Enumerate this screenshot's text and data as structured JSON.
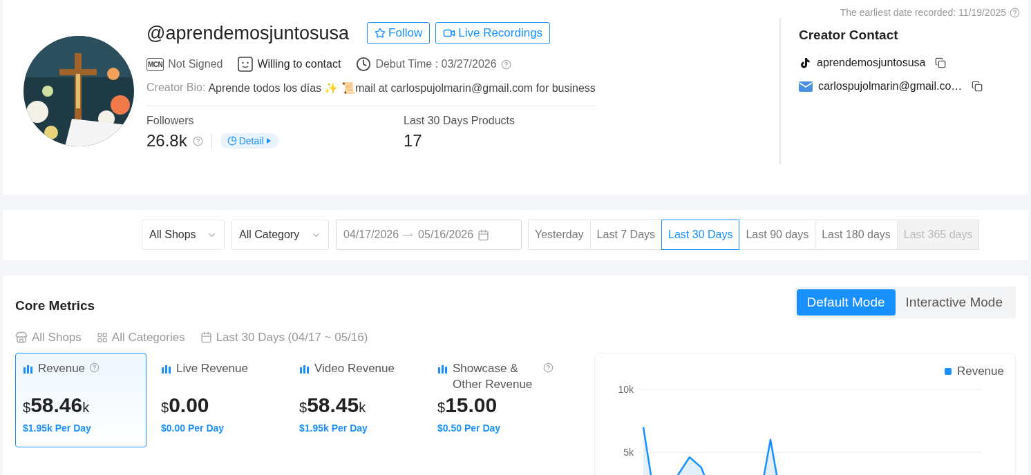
{
  "earliest_date": "The earliest date recorded: 11/19/2025",
  "profile": {
    "handle": "@aprendemosjuntosusa",
    "follow_button": "Follow",
    "live_button": "Live Recordings",
    "mcn_badge": "MCN",
    "mcn_status": "Not Signed",
    "contact_status": "Willing to contact",
    "debut": "Debut Time : 03/27/2026",
    "bio_label": "Creator Bio:",
    "bio": "Aprende todos los días ✨ 📜mail at carlospujolmarin@gmail.com for business",
    "stats": [
      {
        "label": "Followers",
        "value": "26.8k",
        "detail": "Detail"
      },
      {
        "label": "Last 30 Days Products",
        "value": "17"
      }
    ]
  },
  "contact": {
    "title": "Creator Contact",
    "items": [
      {
        "kind": "tiktok",
        "text": "aprendemosjuntosusa"
      },
      {
        "kind": "email",
        "text": "carlospujolmarin@gmail.co…"
      }
    ]
  },
  "filters": {
    "shop": "All Shops",
    "category": "All Category",
    "date_start": "04/17/2026",
    "date_end": "05/16/2026",
    "ranges": [
      {
        "label": "Yesterday",
        "selected": false,
        "disabled": false
      },
      {
        "label": "Last 7 Days",
        "selected": false,
        "disabled": false
      },
      {
        "label": "Last 30 Days",
        "selected": true,
        "disabled": false
      },
      {
        "label": "Last 90 days",
        "selected": false,
        "disabled": false
      },
      {
        "label": "Last 180 days",
        "selected": false,
        "disabled": false
      },
      {
        "label": "Last 365 days",
        "selected": false,
        "disabled": true
      }
    ]
  },
  "core_metrics": {
    "title": "Core Metrics",
    "modes": [
      {
        "label": "Default Mode",
        "selected": true
      },
      {
        "label": "Interactive Mode",
        "selected": false
      }
    ],
    "summary": [
      {
        "kind": "shop",
        "text": "All Shops"
      },
      {
        "kind": "category",
        "text": "All Categories"
      },
      {
        "kind": "date",
        "text": "Last 30 Days (04/17 ~ 05/16)"
      }
    ],
    "metrics": [
      {
        "label": "Revenue",
        "currency": "$",
        "amount": "58.46",
        "unit": "k",
        "per_day": "$1.95k Per Day",
        "selected": true,
        "help": true
      },
      {
        "label": "Live Revenue",
        "currency": "$",
        "amount": "0.00",
        "per_day": "$0.00 Per Day",
        "selected": false,
        "help": false
      },
      {
        "label": "Video Revenue",
        "currency": "$",
        "amount": "58.45",
        "unit": "k",
        "per_day": "$1.95k Per Day",
        "selected": false,
        "help": false
      },
      {
        "label": "Showcase & Other Revenue",
        "currency": "$",
        "amount": "15.00",
        "per_day": "$0.50 Per Day",
        "selected": false,
        "help": true
      }
    ],
    "chart": {
      "chart_data": {
        "type": "area",
        "categories": [
          null,
          null,
          null,
          null,
          null,
          null,
          null,
          null,
          null,
          null,
          null,
          null,
          null,
          null,
          null,
          null,
          null,
          null,
          null,
          null,
          null,
          null,
          null,
          null,
          null,
          null,
          null,
          null,
          null,
          null
        ],
        "ylim": [
          0,
          10000
        ],
        "yticks": [
          {
            "value": 5000,
            "label": "5k"
          },
          {
            "value": 10000,
            "label": "10k"
          }
        ],
        "series": [
          {
            "name": "Revenue",
            "color": "#1890ff",
            "values": [
              7000,
              1200,
              800,
              3200,
              4600,
              3800,
              1500,
              900,
              700,
              600,
              900,
              6000,
              800,
              600,
              500,
              400,
              300,
              300,
              200,
              200,
              200,
              200,
              200,
              200,
              200,
              200,
              200,
              200,
              200,
              200
            ]
          }
        ]
      }
    }
  }
}
